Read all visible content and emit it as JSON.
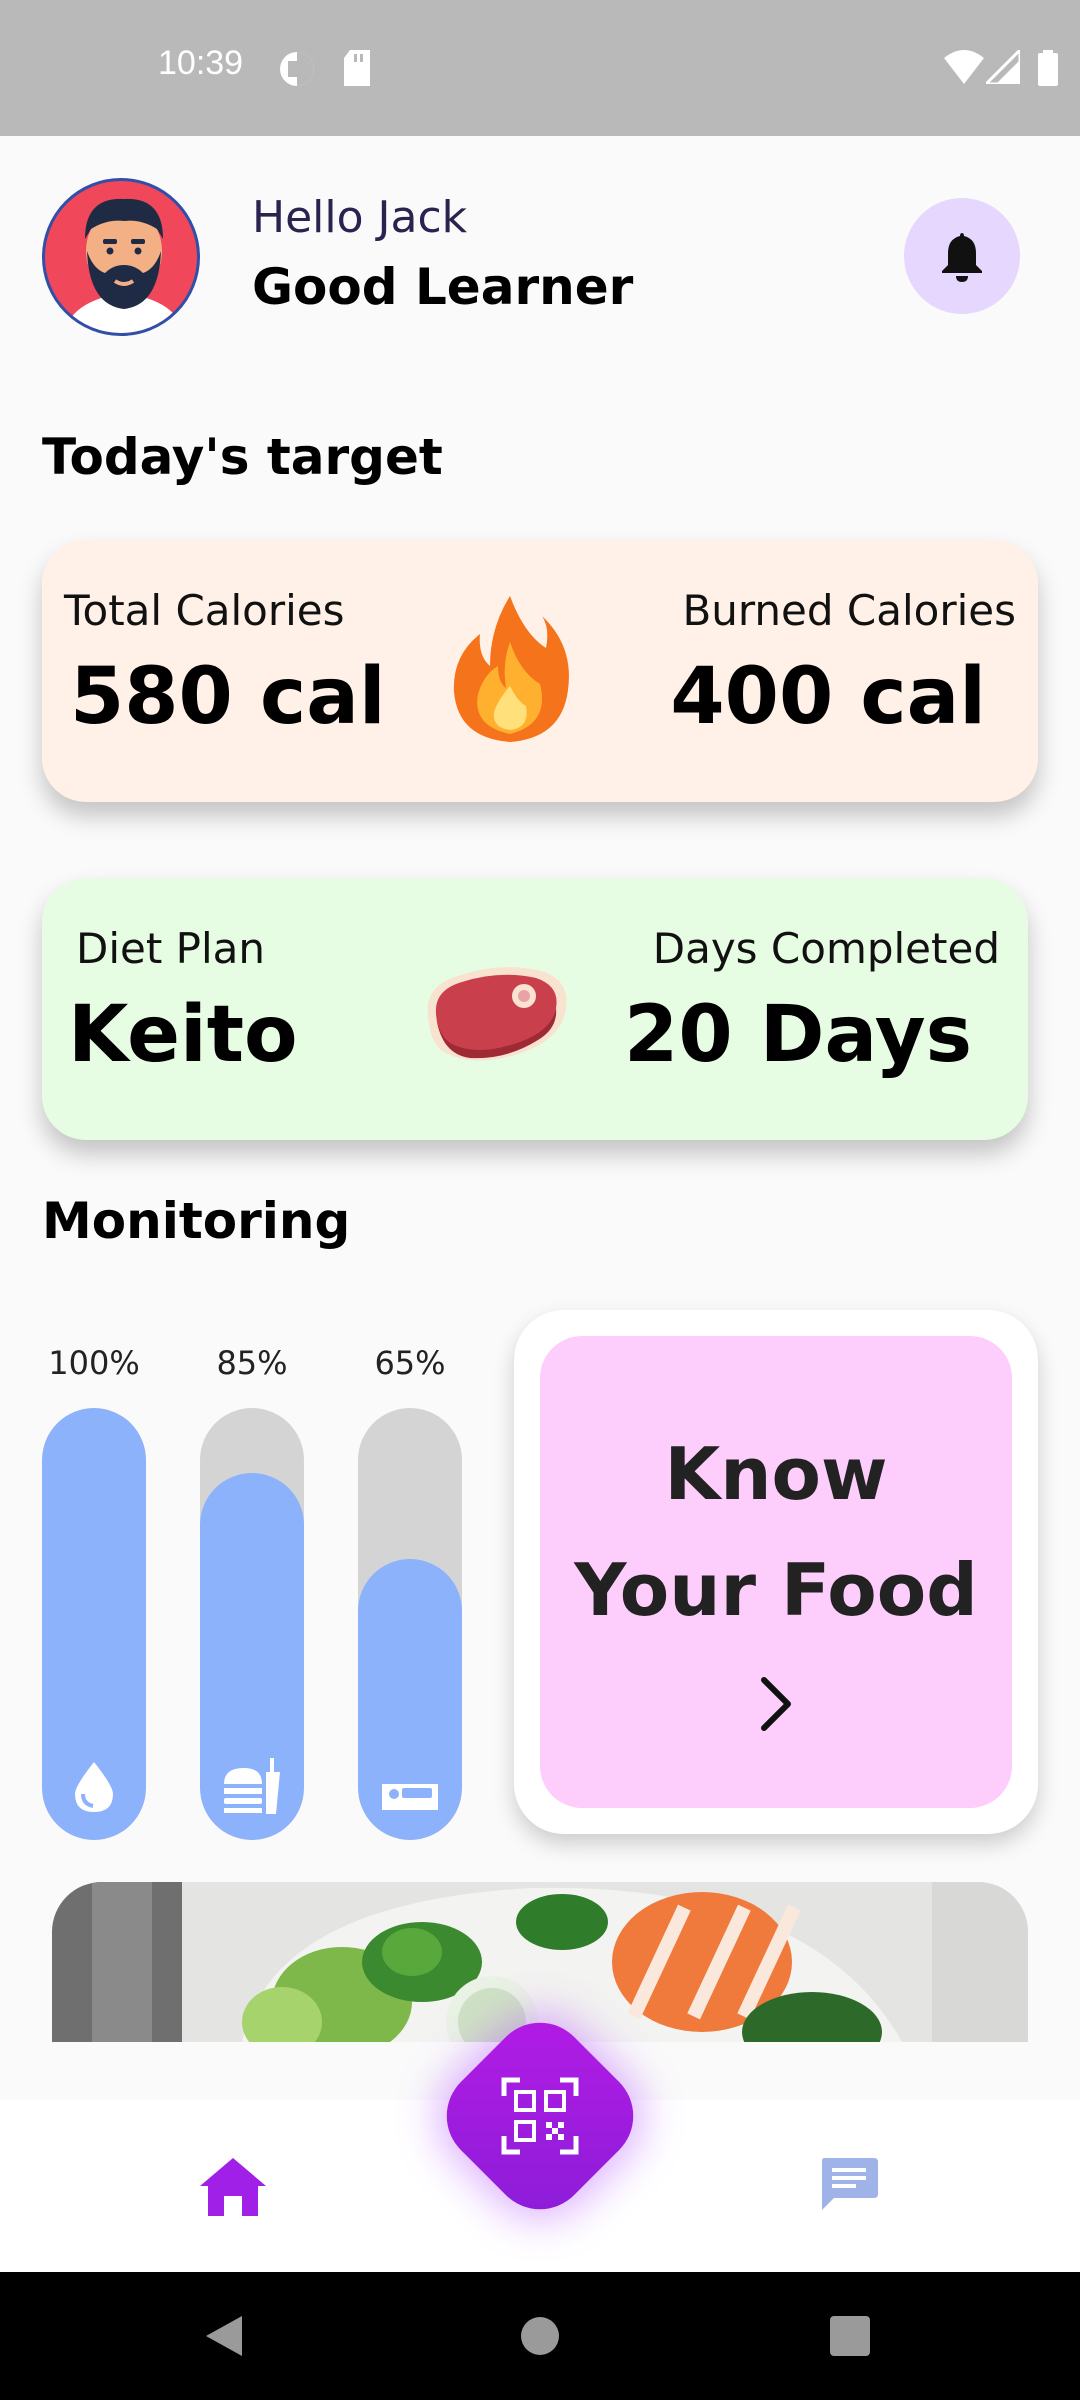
{
  "status_bar": {
    "time": "10:39"
  },
  "header": {
    "greeting": "Hello Jack",
    "username": "Good Learner"
  },
  "sections": {
    "today_target": "Today's target",
    "monitoring": "Monitoring"
  },
  "calories_card": {
    "total_label": "Total Calories",
    "total_value": "580 cal",
    "burned_label": "Burned Calories",
    "burned_value": "400 cal",
    "bg_color": "#fff1e7"
  },
  "diet_card": {
    "plan_label": "Diet Plan",
    "plan_value": "Keito",
    "days_label": "Days Completed",
    "days_value": "20 Days",
    "bg_color": "#e7fde3"
  },
  "monitoring": {
    "bars": [
      {
        "percent_label": "100%",
        "level": 1.0,
        "icon": "water-drop-icon"
      },
      {
        "percent_label": "85%",
        "level": 0.85,
        "icon": "food-icon"
      },
      {
        "percent_label": "65%",
        "level": 0.65,
        "icon": "bed-icon"
      }
    ],
    "bar_fill_color": "#8cb2fb"
  },
  "know_food": {
    "line1": "Know",
    "line2": "Your Food"
  },
  "bottom_nav": {
    "items": [
      "home-icon",
      "qr-scan-icon",
      "chat-icon"
    ],
    "accent": "#a020e8"
  }
}
